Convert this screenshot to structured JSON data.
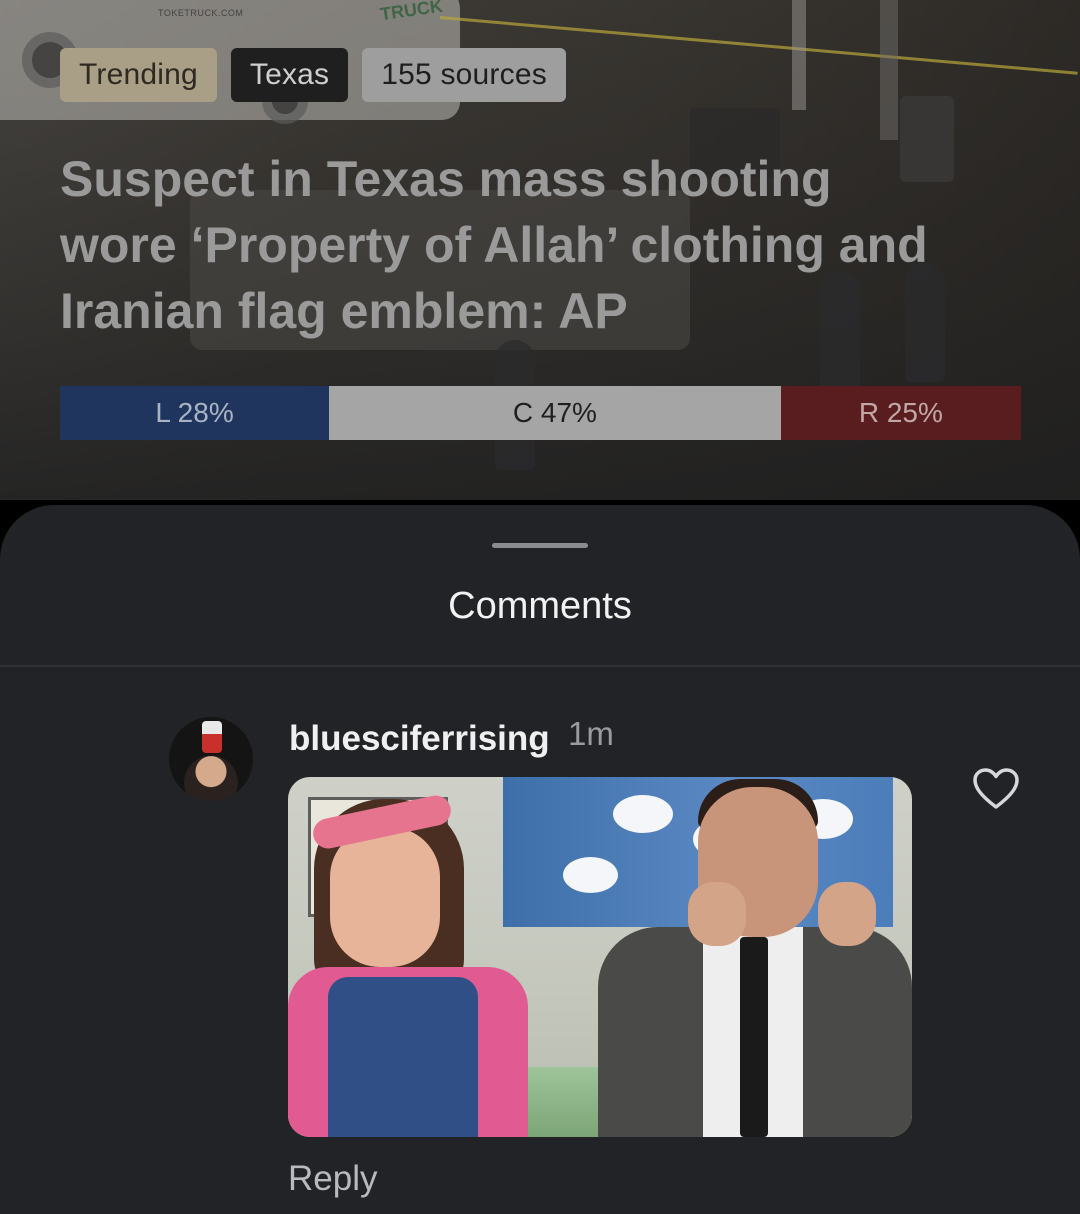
{
  "story": {
    "chips": {
      "trending": "Trending",
      "topic": "Texas",
      "sources": "155 sources"
    },
    "headline": "Suspect in Texas mass shooting wore ‘Property of Allah’ clothing and Iranian flag emblem: AP",
    "bias": {
      "left_label": "L 28%",
      "center_label": "C 47%",
      "right_label": "R 25%",
      "left_pct": 28,
      "center_pct": 47,
      "right_pct": 25,
      "colors": {
        "left": "#1f355e",
        "center": "#a5a5a5",
        "right": "#5a1d1f"
      }
    },
    "photo_text": {
      "van_url": "TOKETRUCK.COM",
      "van_logo": "TRUCK"
    }
  },
  "comments_sheet": {
    "title": "Comments",
    "comments": [
      {
        "username": "bluesciferrising",
        "time": "1m",
        "has_gif": true,
        "reply_label": "Reply",
        "liked": false
      }
    ]
  },
  "icons": {
    "like": "heart-outline-icon"
  }
}
